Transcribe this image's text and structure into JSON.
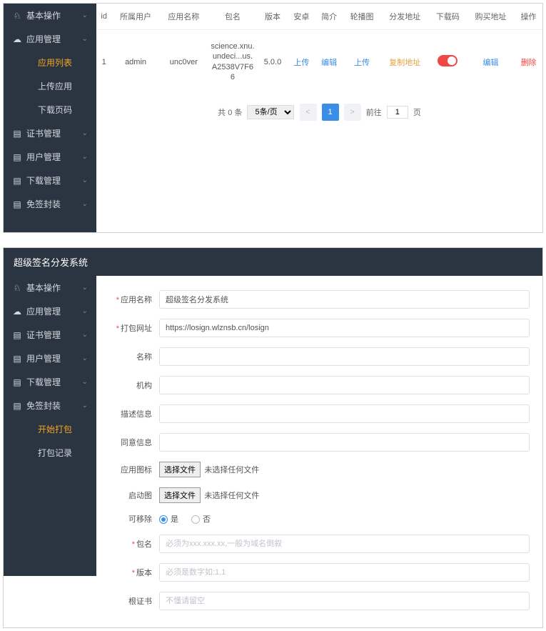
{
  "panel1": {
    "sidebar": [
      {
        "label": "基本操作",
        "icon": "user",
        "active": false,
        "sub": false,
        "expand": true
      },
      {
        "label": "应用管理",
        "icon": "cloud",
        "active": false,
        "sub": false,
        "expand": true
      },
      {
        "label": "应用列表",
        "icon": "",
        "active": true,
        "sub": true,
        "expand": false
      },
      {
        "label": "上传应用",
        "icon": "",
        "active": false,
        "sub": true,
        "expand": false
      },
      {
        "label": "下载页码",
        "icon": "",
        "active": false,
        "sub": true,
        "expand": false
      },
      {
        "label": "证书管理",
        "icon": "doc",
        "active": false,
        "sub": false,
        "expand": true
      },
      {
        "label": "用户管理",
        "icon": "doc",
        "active": false,
        "sub": false,
        "expand": true
      },
      {
        "label": "下载管理",
        "icon": "doc",
        "active": false,
        "sub": false,
        "expand": true
      },
      {
        "label": "免签封装",
        "icon": "doc",
        "active": false,
        "sub": false,
        "expand": true
      }
    ],
    "table": {
      "headers": [
        "id",
        "所属用户",
        "应用名称",
        "包名",
        "版本",
        "安卓",
        "简介",
        "轮播图",
        "分发地址",
        "下载码",
        "购买地址",
        "操作"
      ],
      "row": {
        "id": "1",
        "user": "admin",
        "app": "unc0ver",
        "pkg": "science.xnu.undeci...us.A2538V7F66",
        "ver": "5.0.0",
        "android": "上传",
        "intro": "编辑",
        "carousel": "上传",
        "dist": "复制地址",
        "buy": "编辑",
        "op": "删除"
      }
    },
    "pager": {
      "total": "共 0 条",
      "size": "5条/页",
      "page": "1",
      "goto": "前往",
      "gotoVal": "1",
      "unit": "页"
    }
  },
  "panel2": {
    "title": "超级签名分发系统",
    "sidebar": [
      {
        "label": "基本操作",
        "icon": "user",
        "active": false,
        "sub": false,
        "expand": true
      },
      {
        "label": "应用管理",
        "icon": "cloud",
        "active": false,
        "sub": false,
        "expand": true
      },
      {
        "label": "证书管理",
        "icon": "doc",
        "active": false,
        "sub": false,
        "expand": true
      },
      {
        "label": "用户管理",
        "icon": "doc",
        "active": false,
        "sub": false,
        "expand": true
      },
      {
        "label": "下载管理",
        "icon": "doc",
        "active": false,
        "sub": false,
        "expand": true
      },
      {
        "label": "免签封装",
        "icon": "doc",
        "active": false,
        "sub": false,
        "expand": true
      },
      {
        "label": "开始打包",
        "icon": "",
        "active": true,
        "sub": true,
        "expand": false
      },
      {
        "label": "打包记录",
        "icon": "",
        "active": false,
        "sub": true,
        "expand": false
      }
    ],
    "form": {
      "appName": {
        "label": "应用名称",
        "value": "超级签名分发系统",
        "req": true
      },
      "url": {
        "label": "打包网址",
        "value": "https://losign.wlznsb.cn/losign",
        "req": true
      },
      "name": {
        "label": "名称",
        "value": "",
        "req": false
      },
      "org": {
        "label": "机构",
        "value": "",
        "req": false
      },
      "desc": {
        "label": "描述信息",
        "value": "",
        "req": false
      },
      "agree": {
        "label": "同意信息",
        "value": "",
        "req": false
      },
      "icon": {
        "label": "应用图标",
        "btn": "选择文件",
        "txt": "未选择任何文件",
        "req": false
      },
      "splash": {
        "label": "启动图",
        "btn": "选择文件",
        "txt": "未选择任何文件",
        "req": false
      },
      "removable": {
        "label": "可移除",
        "yes": "是",
        "no": "否",
        "req": false
      },
      "pkg": {
        "label": "包名",
        "placeholder": "必须为xxx.xxx.xx,一般为域名倒叙",
        "req": true
      },
      "ver": {
        "label": "版本",
        "placeholder": "必须是数字如:1.1",
        "req": true
      },
      "cert": {
        "label": "根证书",
        "placeholder": "不懂请留空",
        "req": false
      }
    }
  }
}
